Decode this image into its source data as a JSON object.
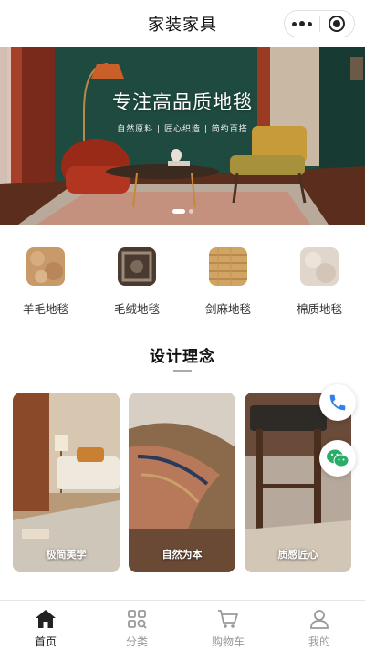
{
  "header": {
    "title": "家装家具",
    "more_icon": "more-dots-icon",
    "capsule_close_icon": "target-circle-icon"
  },
  "banner": {
    "title": "专注高品质地毯",
    "subtitle": "自然原料 | 匠心织造 | 简约百搭",
    "slide_count": 2,
    "active_slide": 1
  },
  "categories": [
    {
      "label": "羊毛地毯",
      "icon": "wool-rug-thumbnail"
    },
    {
      "label": "毛绒地毯",
      "icon": "plush-rug-thumbnail"
    },
    {
      "label": "剑麻地毯",
      "icon": "sisal-rug-thumbnail"
    },
    {
      "label": "棉质地毯",
      "icon": "cotton-rug-thumbnail"
    }
  ],
  "design": {
    "title": "设计理念",
    "cards": [
      {
        "caption": "极简美学"
      },
      {
        "caption": "自然为本"
      },
      {
        "caption": "质感匠心"
      }
    ]
  },
  "floating": {
    "phone_icon": "phone-icon",
    "wechat_icon": "wechat-icon",
    "phone_color": "#2f80ed",
    "wechat_color": "#2aae67"
  },
  "tabbar": {
    "items": [
      {
        "label": "首页",
        "icon": "home-icon",
        "active": true
      },
      {
        "label": "分类",
        "icon": "category-grid-icon",
        "active": false
      },
      {
        "label": "购物车",
        "icon": "cart-icon",
        "active": false
      },
      {
        "label": "我的",
        "icon": "user-icon",
        "active": false
      }
    ]
  },
  "colors": {
    "banner_wall": "#1f4a40",
    "accent_text": "#222222",
    "inactive_text": "#999999"
  }
}
